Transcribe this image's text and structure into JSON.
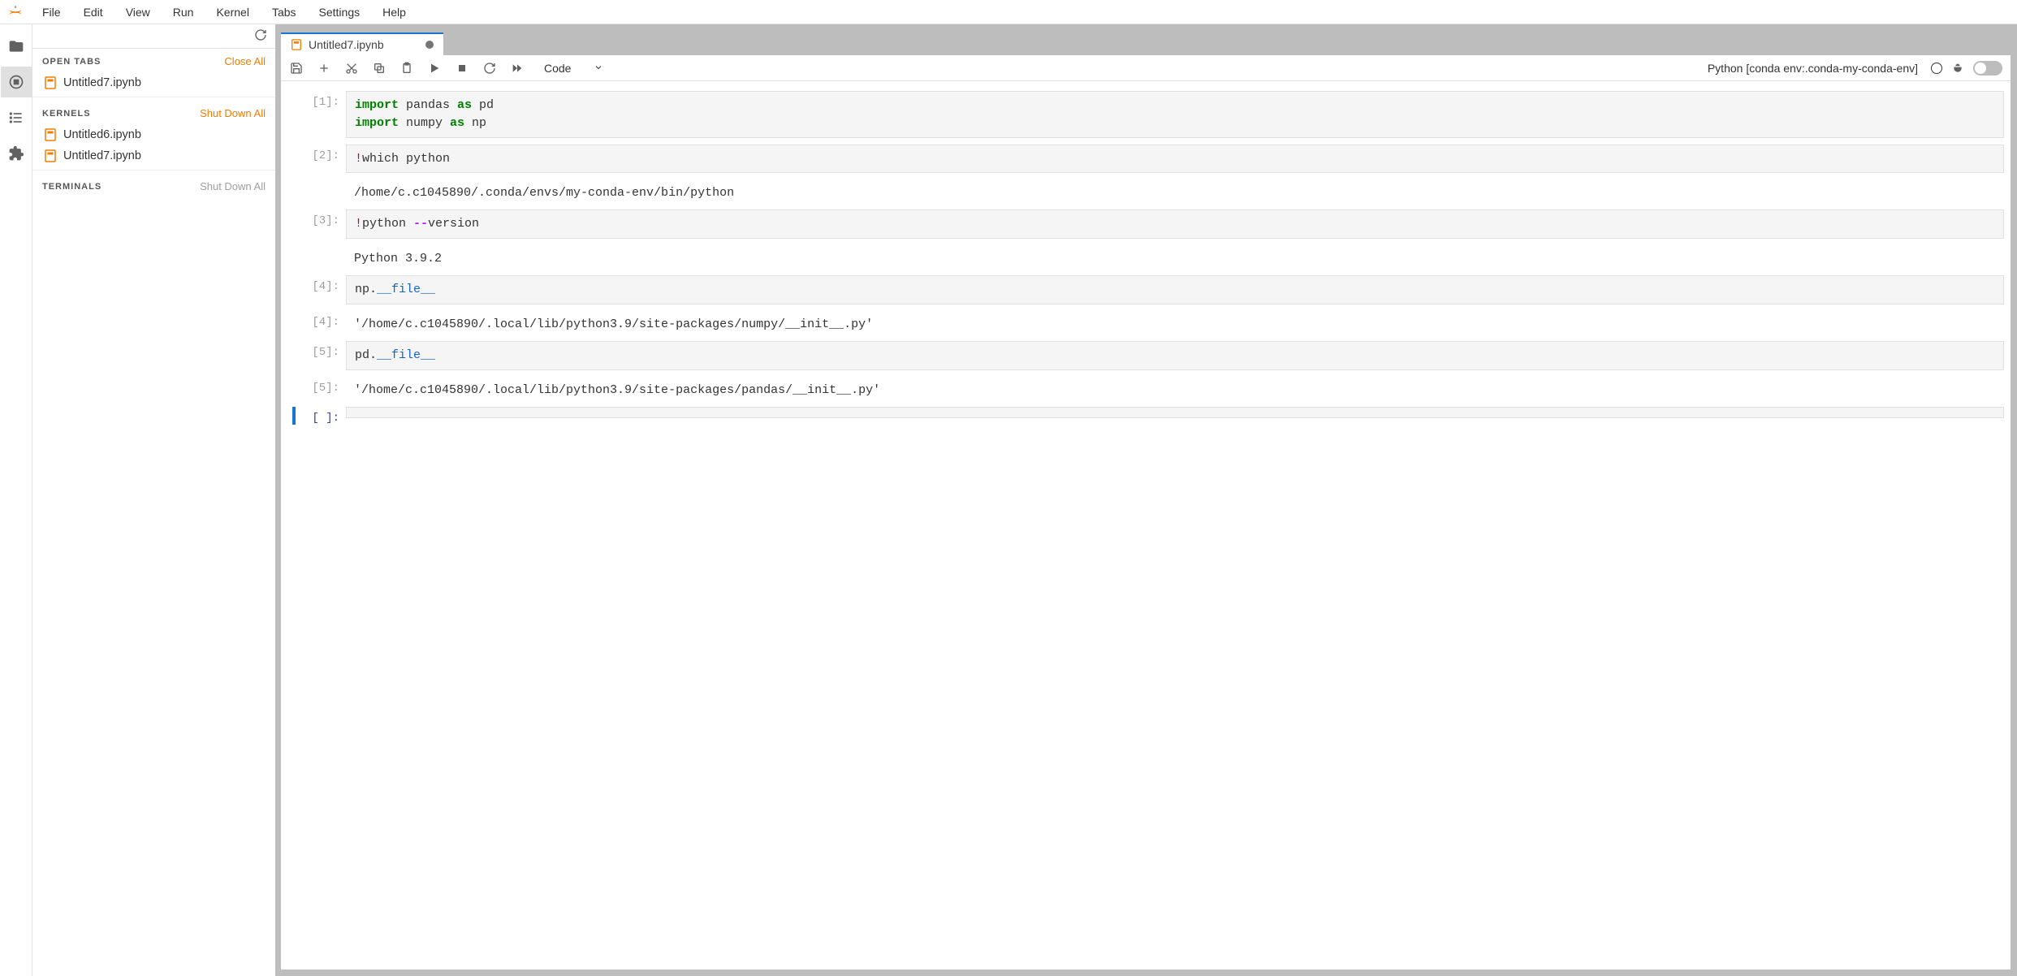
{
  "menu": {
    "file": "File",
    "edit": "Edit",
    "view": "View",
    "run": "Run",
    "kernel": "Kernel",
    "tabs": "Tabs",
    "settings": "Settings",
    "help": "Help"
  },
  "panel": {
    "open_tabs_title": "OPEN TABS",
    "close_all": "Close All",
    "kernels_title": "KERNELS",
    "shut_down_all": "Shut Down All",
    "terminals_title": "TERMINALS",
    "shut_down_all_grey": "Shut Down All",
    "open_tabs": [
      {
        "label": "Untitled7.ipynb"
      }
    ],
    "kernels": [
      {
        "label": "Untitled6.ipynb"
      },
      {
        "label": "Untitled7.ipynb"
      }
    ]
  },
  "tab": {
    "title": "Untitled7.ipynb"
  },
  "toolbar": {
    "cell_type": "Code",
    "kernel_name": "Python [conda env:.conda-my-conda-env]"
  },
  "cells": [
    {
      "prompt": "[1]:",
      "code_html": "<span class=\"kw\">import</span> pandas <span class=\"kw\">as</span> pd\n<span class=\"kw\">import</span> numpy <span class=\"kw\">as</span> np"
    },
    {
      "prompt": "[2]:",
      "code_html": "<span class=\"bang\">!</span>which python",
      "output": "/home/c.c1045890/.conda/envs/my-conda-env/bin/python"
    },
    {
      "prompt": "[3]:",
      "code_html": "<span class=\"bang\">!</span>python <span class=\"op\">--</span>version",
      "output": "Python 3.9.2"
    },
    {
      "prompt": "[4]:",
      "code_html": "np.<span class=\"dunder\">__file__</span>",
      "out_prompt": "[4]:",
      "output": "'/home/c.c1045890/.local/lib/python3.9/site-packages/numpy/__init__.py'"
    },
    {
      "prompt": "[5]:",
      "code_html": "pd.<span class=\"dunder\">__file__</span>",
      "out_prompt": "[5]:",
      "output": "'/home/c.c1045890/.local/lib/python3.9/site-packages/pandas/__init__.py'"
    },
    {
      "prompt": "[ ]:",
      "code_html": "",
      "active": true
    }
  ]
}
